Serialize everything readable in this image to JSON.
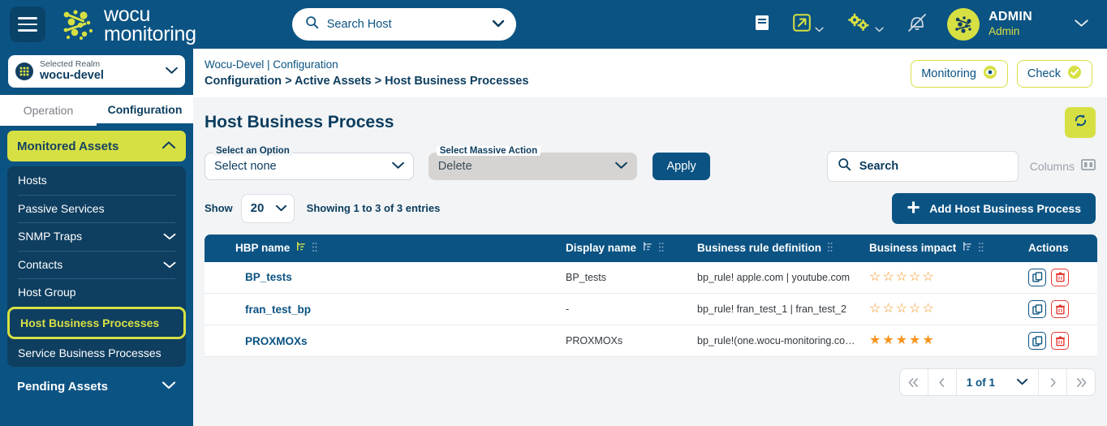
{
  "brand": {
    "line1": "wocu",
    "line2": "monitoring"
  },
  "topbar": {
    "menu_icon": "hamburger-icon",
    "search": {
      "placeholder": "Search Host",
      "value": "",
      "icon": "search-icon",
      "caret": "chevron-down-icon"
    },
    "icons": [
      {
        "name": "book-icon",
        "caret": false
      },
      {
        "name": "external-link-icon",
        "caret": true
      },
      {
        "name": "gears-icon",
        "caret": true
      },
      {
        "name": "notifications-off-icon",
        "caret": false
      }
    ],
    "user": {
      "name": "ADMIN",
      "role": "Admin",
      "caret": "chevron-down-icon"
    }
  },
  "sidebar": {
    "realm": {
      "label": "Selected Realm",
      "value": "wocu-devel",
      "caret": "chevron-down-icon"
    },
    "tabs": [
      {
        "label": "Operation",
        "active": false
      },
      {
        "label": "Configuration",
        "active": true
      }
    ],
    "groups": [
      {
        "label": "Monitored Assets",
        "expanded": true,
        "chevron": "chevron-up-icon",
        "items": [
          {
            "label": "Hosts",
            "chevron": null,
            "selected": false
          },
          {
            "label": "Passive Services",
            "chevron": null,
            "selected": false
          },
          {
            "label": "SNMP Traps",
            "chevron": "chevron-down-icon",
            "selected": false
          },
          {
            "label": "Contacts",
            "chevron": "chevron-down-icon",
            "selected": false
          },
          {
            "label": "Host Group",
            "chevron": null,
            "selected": false
          },
          {
            "label": "Host Business Processes",
            "chevron": null,
            "selected": true
          },
          {
            "label": "Service Business Processes",
            "chevron": null,
            "selected": false
          }
        ]
      },
      {
        "label": "Pending Assets",
        "expanded": false,
        "chevron": "chevron-down-icon",
        "items": []
      }
    ]
  },
  "breadcrumb": {
    "line1": "Wocu-Devel | Configuration",
    "line2": "Configuration > Active Assets > Host Business Processes",
    "buttons": [
      {
        "label": "Monitoring",
        "icon": "eye-icon"
      },
      {
        "label": "Check",
        "icon": "check-circle-icon"
      }
    ]
  },
  "page": {
    "title": "Host Business Process",
    "refresh_icon": "refresh-icon"
  },
  "filters": {
    "option_select": {
      "label": "Select an Option",
      "value": "Select none",
      "caret": "chevron-down-icon"
    },
    "massive_action": {
      "label": "Select Massive Action",
      "value": "Delete",
      "caret": "chevron-down-icon",
      "disabled": true
    },
    "apply_label": "Apply",
    "search": {
      "placeholder": "Search",
      "value": "",
      "icon": "search-icon"
    },
    "columns_label": "Columns",
    "columns_icon": "columns-icon"
  },
  "list_controls": {
    "show_label": "Show",
    "show_value": "20",
    "showing_text": "Showing 1 to 3 of 3 entries",
    "add_label": "Add Host Business Process",
    "add_icon": "plus-icon"
  },
  "table": {
    "columns": [
      {
        "label": "HBP name",
        "sort_icon": "sort-asc-icon",
        "sort_active": true,
        "grip_icon": "grip-icon"
      },
      {
        "label": "Display name",
        "sort_icon": "sort-asc-icon",
        "sort_active": false,
        "grip_icon": "grip-icon"
      },
      {
        "label": "Business rule definition",
        "sort_icon": null,
        "sort_active": false,
        "grip_icon": "grip-icon"
      },
      {
        "label": "Business impact",
        "sort_icon": "sort-asc-icon",
        "sort_active": false,
        "grip_icon": "grip-icon"
      },
      {
        "label": "Actions",
        "sort_icon": null,
        "sort_active": false,
        "grip_icon": null
      }
    ],
    "rows": [
      {
        "hbp_name": "BP_tests",
        "display_name": "BP_tests",
        "business_rule": "bp_rule! apple.com | youtube.com",
        "impact": 0,
        "impact_stars": "☆☆☆☆☆",
        "actions": [
          {
            "name": "duplicate-button",
            "icon": "copy-icon"
          },
          {
            "name": "delete-button",
            "icon": "trash-icon"
          }
        ]
      },
      {
        "hbp_name": "fran_test_bp",
        "display_name": "-",
        "business_rule": "bp_rule! fran_test_1 | fran_test_2",
        "impact": 0,
        "impact_stars": "☆☆☆☆☆",
        "actions": [
          {
            "name": "duplicate-button",
            "icon": "copy-icon"
          },
          {
            "name": "delete-button",
            "icon": "trash-icon"
          }
        ]
      },
      {
        "hbp_name": "PROXMOXs",
        "display_name": "PROXMOXs",
        "business_rule": "bp_rule!(one.wocu-monitoring.com & thr...",
        "impact": 5,
        "impact_stars": "★★★★★",
        "actions": [
          {
            "name": "duplicate-button",
            "icon": "copy-icon"
          },
          {
            "name": "delete-button",
            "icon": "trash-icon"
          }
        ]
      }
    ]
  },
  "pagination": {
    "first_icon": "double-chevron-left-icon",
    "prev_icon": "chevron-left-icon",
    "label": "1 of 1",
    "caret": "chevron-down-icon",
    "next_icon": "chevron-right-icon",
    "last_icon": "double-chevron-right-icon"
  },
  "colors": {
    "primary": "#0b5383",
    "dark": "#0e3e60",
    "accent": "#d7e043",
    "star": "#f7941e",
    "danger": "#e53935",
    "page_bg": "#f2f4f6"
  }
}
